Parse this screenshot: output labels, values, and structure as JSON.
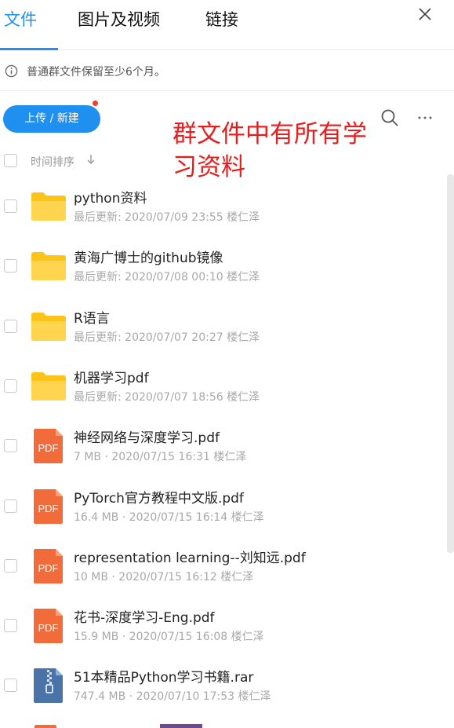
{
  "tabs": [
    {
      "label": "文件",
      "active": true
    },
    {
      "label": "图片及视频",
      "active": false
    },
    {
      "label": "链接",
      "active": false
    }
  ],
  "notice": {
    "text": "普通群文件保留至少6个月。"
  },
  "toolbar": {
    "upload_label": "上传 / 新建"
  },
  "annotation": {
    "text": "群文件中有所有学习资料"
  },
  "sort": {
    "label": "时间排序"
  },
  "files": [
    {
      "type": "folder",
      "name": "python资料",
      "meta": "最后更新: 2020/07/09 23:55  楼仁泽"
    },
    {
      "type": "folder",
      "name": "黄海广博士的github镜像",
      "meta": "最后更新: 2020/07/08 00:10  楼仁泽"
    },
    {
      "type": "folder",
      "name": "R语言",
      "meta": "最后更新: 2020/07/07 20:27  楼仁泽"
    },
    {
      "type": "folder",
      "name": "机器学习pdf",
      "meta": "最后更新: 2020/07/07 18:56  楼仁泽"
    },
    {
      "type": "pdf",
      "name": "神经网络与深度学习.pdf",
      "meta": "7 MB  ·  2020/07/15 16:31  楼仁泽"
    },
    {
      "type": "pdf",
      "name": "PyTorch官方教程中文版.pdf",
      "meta": "16.4 MB  ·  2020/07/15 16:14  楼仁泽"
    },
    {
      "type": "pdf",
      "name": "representation learning--刘知远.pdf",
      "meta": "10 MB  ·  2020/07/15 16:12  楼仁泽"
    },
    {
      "type": "pdf",
      "name": "花书-深度学习-Eng.pdf",
      "meta": "15.9 MB  ·  2020/07/15 16:08  楼仁泽"
    },
    {
      "type": "rar",
      "name": "51本精品Python学习书籍.rar",
      "meta": "747.4 MB  ·  2020/07/10 17:53  楼仁泽"
    }
  ],
  "icons": {
    "pdf_badge": "PDF"
  },
  "colors": {
    "accent": "#1f8ff0",
    "folder": "#fcc419",
    "pdf": "#f26b3a",
    "archive": "#4a74a8",
    "annotation": "#e81d1d"
  }
}
